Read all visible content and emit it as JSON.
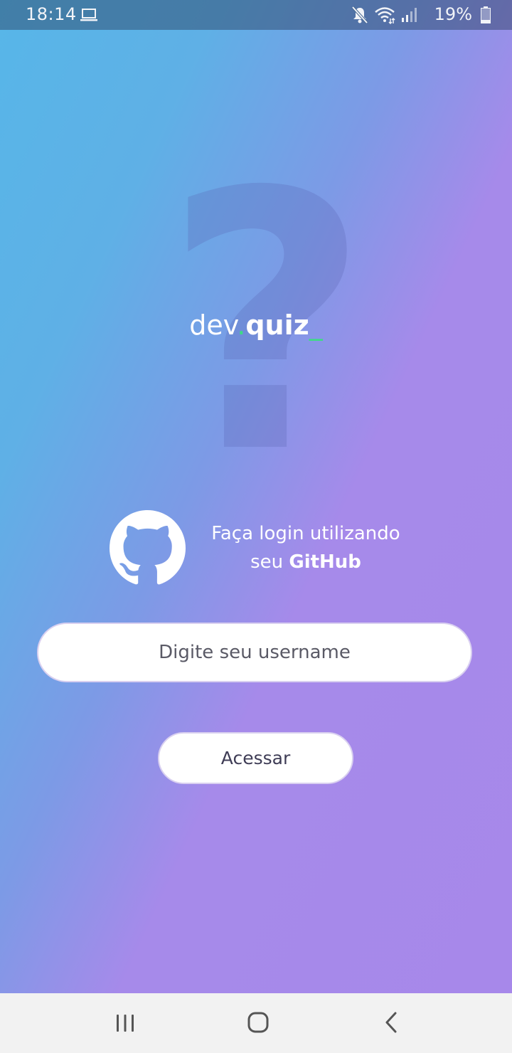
{
  "status_bar": {
    "time": "18:14",
    "battery": "19%",
    "icons": [
      "laptop-icon",
      "mute-icon",
      "wifi-icon",
      "signal-icon",
      "battery-icon"
    ]
  },
  "watermark": {
    "glyph": "?"
  },
  "logo": {
    "part1": "dev",
    "dot": ".",
    "part2": "quiz",
    "underscore": "_"
  },
  "login": {
    "line1": "Faça login utilizando",
    "line2_prefix": "seu ",
    "line2_strong": "GitHub",
    "icon": "github-icon"
  },
  "username_input": {
    "placeholder": "Digite seu username",
    "value": ""
  },
  "access_button": {
    "label": "Acessar"
  },
  "nav_bar": {
    "icons": [
      "recent-apps-icon",
      "home-icon",
      "back-icon"
    ]
  },
  "colors": {
    "gradient_start": "#57b6e8",
    "gradient_end": "#a788ea",
    "accent_green": "#3ddc84",
    "button_text": "#3f3d56"
  }
}
